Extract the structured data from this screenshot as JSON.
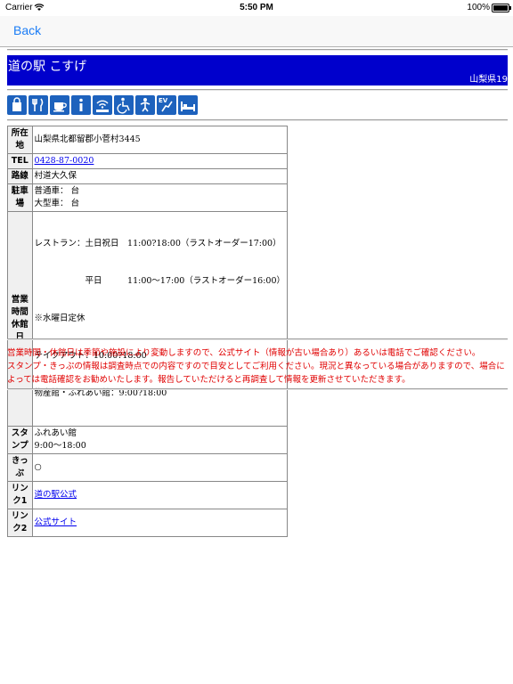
{
  "status_bar": {
    "carrier": "Carrier",
    "time": "5:50 PM",
    "battery": "100%"
  },
  "nav": {
    "back_label": "Back"
  },
  "station": {
    "name": "道の駅 こすげ",
    "prefecture": "山梨県19"
  },
  "facility_icons": [
    "shopping-bag-icon",
    "restaurant-icon",
    "cafe-icon",
    "info-icon",
    "wifi-icon",
    "wheelchair-icon",
    "baby-care-icon",
    "ev-charger-icon",
    "hotel-bed-icon"
  ],
  "info": {
    "address": {
      "label": "所在地",
      "value": "山梨県北都留郡小菅村3445"
    },
    "tel": {
      "label": "TEL",
      "value": "0428-87-0020"
    },
    "route": {
      "label": "路線",
      "value": "村道大久保"
    },
    "parking": {
      "label": "駐車場",
      "line1": "普通車： 台",
      "line2": "大型車： 台"
    },
    "hours": {
      "label1": "営業時間",
      "label2": "休館日",
      "line1": "レストラン：土日祝日　11:00?18:00（ラストオーダー17:00）",
      "line2": "　　　　　　平日　　　11:00～17:00（ラストオーダー16:00）",
      "line3": "※水曜日定休",
      "line4": "テイクアウト：10:00?18:00",
      "line5": "物産館・ふれあい館：9:00?18:00"
    },
    "stamp": {
      "label": "スタンプ",
      "line1": "ふれあい館",
      "line2": "9:00～18:00"
    },
    "kippu": {
      "label": "きっぷ",
      "value": "○"
    },
    "link1": {
      "label": "リンク1",
      "value": "道の駅公式"
    },
    "link2": {
      "label": "リンク2",
      "value": "公式サイト"
    }
  },
  "notice": {
    "line1": "営業時間・休館日は季節や施設により変動しますので、公式サイト（情報が古い場合あり）あるいは電話でご確認ください。",
    "line2": "スタンプ・きっぷの情報は調査時点での内容ですので目安としてご利用ください。現況と異なっている場合がありますので、場合によっては電話確認をお勧めいたします。報告していただけると再調査して情報を更新させていただきます。"
  },
  "colors": {
    "title_bar": "#0000cc",
    "link": "#0000ee",
    "notice": "#e00000",
    "ios_blue": "#1a7cf6",
    "icon_blue": "#1d62bd"
  }
}
